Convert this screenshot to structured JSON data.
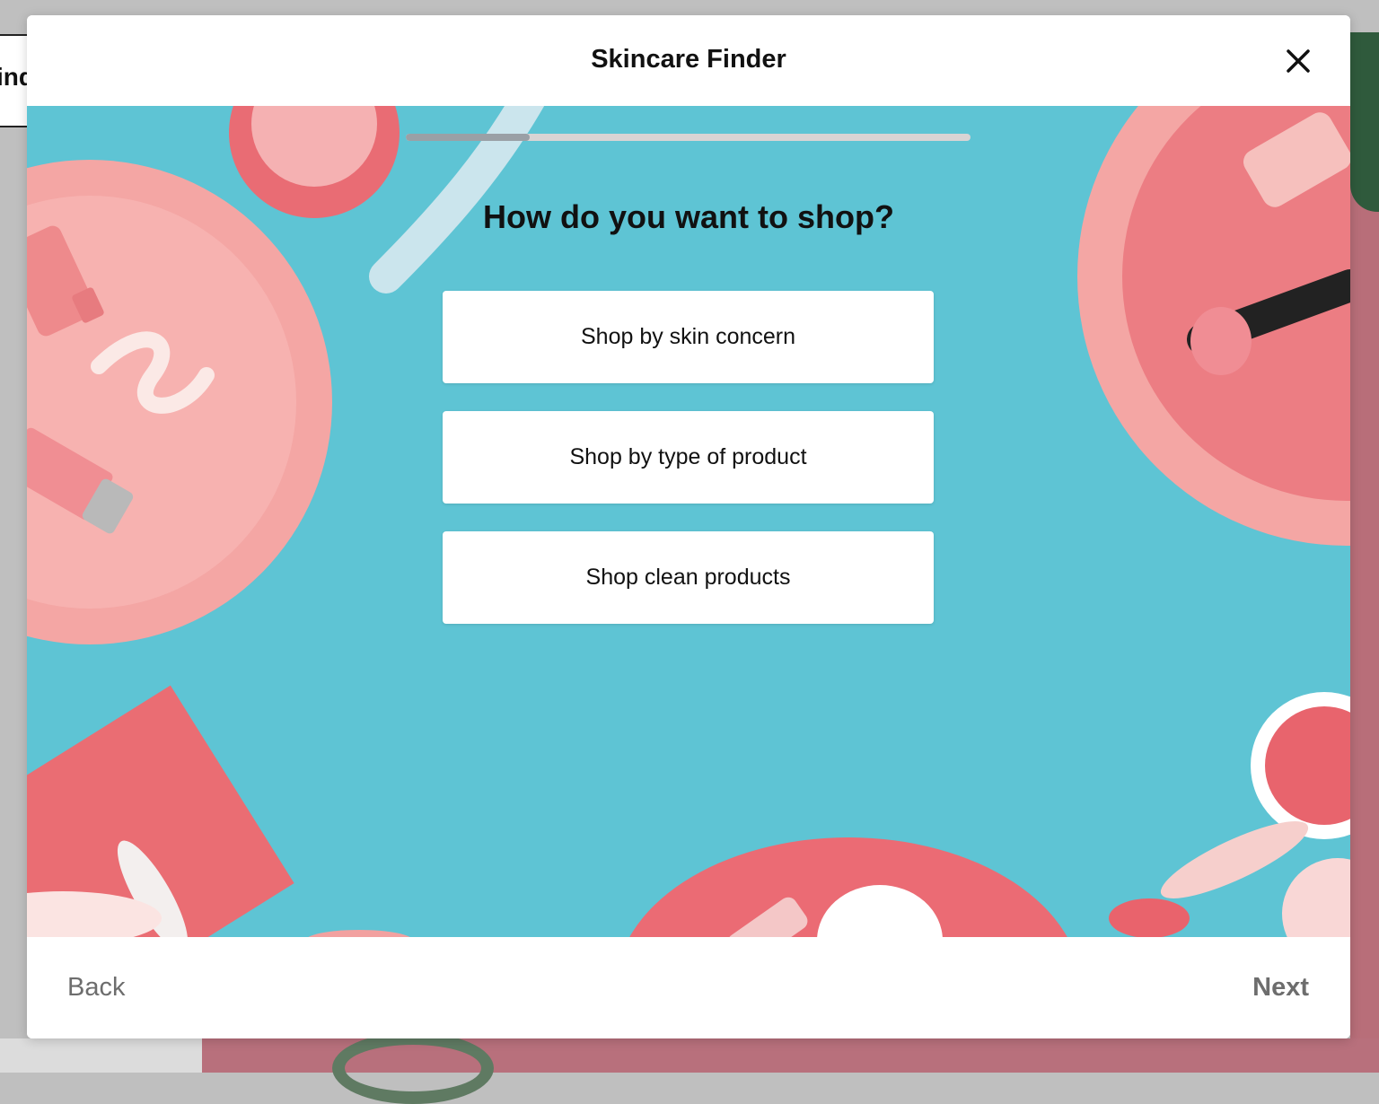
{
  "background_page": {
    "partial_text": "ind"
  },
  "modal": {
    "title": "Skincare Finder",
    "close_icon": "close-icon"
  },
  "quiz": {
    "progress": 0.22,
    "question": "How do you want to shop?",
    "options": [
      "Shop by skin concern",
      "Shop by type of product",
      "Shop clean products"
    ]
  },
  "footer": {
    "back_label": "Back",
    "next_label": "Next"
  },
  "colors": {
    "hero_background": "#5ec4d4",
    "accent_pink": "#f2a3a3",
    "accent_coral": "#e8737a",
    "text": "#111111",
    "muted": "#6d6d6d"
  }
}
